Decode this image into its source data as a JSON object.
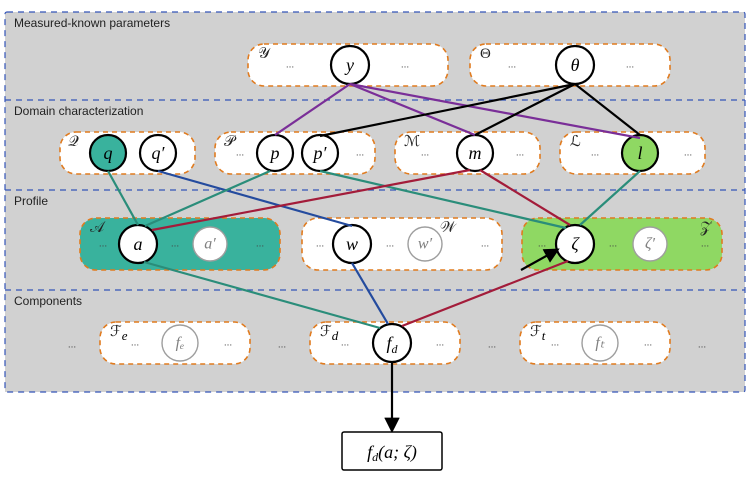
{
  "rows": {
    "measured": "Measured-known parameters",
    "domain": "Domain characterization",
    "profile": "Profile",
    "components": "Components"
  },
  "sets": {
    "Y": "𝒴",
    "Theta": "Θ",
    "Q": "𝒬",
    "P": "𝒫",
    "M": "ℳ",
    "L": "ℒ",
    "A": "𝒜",
    "W": "𝒲",
    "Z": "𝒵",
    "Fe": "ℱₑ",
    "Fd": "𝓕_d",
    "Ft": "ℱₜ"
  },
  "script_labels": {
    "Fe": "e",
    "Fd": "d",
    "Ft": "t"
  },
  "nodes": {
    "y": "y",
    "theta": "θ",
    "q": "q",
    "qp": "q′",
    "p": "p",
    "pp": "p′",
    "m": "m",
    "l": "l",
    "a": "a",
    "ap": "a′",
    "w": "w",
    "wp": "w′",
    "zeta": "ζ",
    "zetap": "ζ′",
    "fe": "fₑ",
    "fd": "f_d",
    "ft": "fₜ"
  },
  "ellipsis": "...",
  "output": "f_d(a; ζ)",
  "output_parts": {
    "fn": "f",
    "sub": "d",
    "args": "(a; ζ)"
  }
}
